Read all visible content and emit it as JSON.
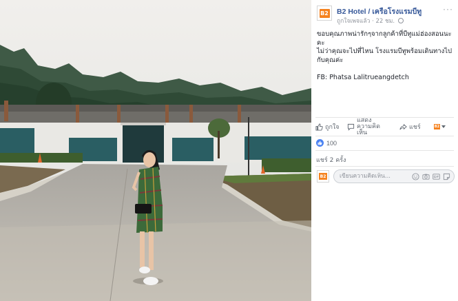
{
  "post": {
    "page_name": "B2 Hotel / เครือโรงแรมบีทู",
    "followed_label": "ถูกใจเพจแล้ว",
    "time": "22 ชม.",
    "logo_text": "B2",
    "text_lines": [
      "ขอบคุณภาพน่ารักๆจากลูกค้าที่บีทูแม่ฮ่องสอนนะคะ",
      "ไม่ว่าคุณจะไปที่ไหน โรงแรมบีทูพร้อมเดินทางไปกับคุณค่ะ"
    ],
    "credit": "FB: Phatsa Lalitrueangdetch"
  },
  "actions": {
    "like": "ถูกใจ",
    "comment": "แสดงความคิดเห็น",
    "share": "แชร์"
  },
  "stats": {
    "reactions": "100",
    "shares": "แชร์ 2 ครั้ง"
  },
  "comment": {
    "placeholder": "เขียนความคิดเห็น..."
  },
  "icons": [
    "more-icon",
    "globe-icon",
    "like-icon",
    "comment-icon",
    "share-icon",
    "chevron-down-icon",
    "emoji-icon",
    "camera-icon",
    "gif-icon",
    "sticker-icon"
  ],
  "colors": {
    "link": "#365899",
    "brand": "#f5821f",
    "like_blue": "#4a82f2",
    "muted": "#90949c"
  }
}
